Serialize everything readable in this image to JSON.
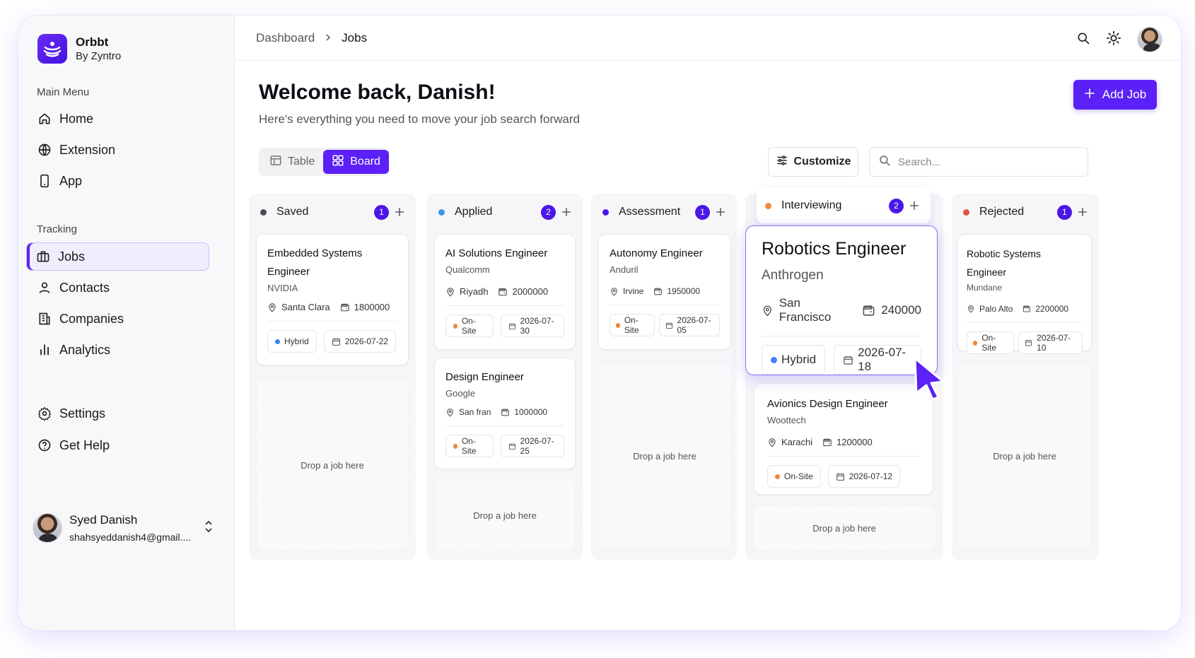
{
  "brand": {
    "name": "Orbbt",
    "sub": "By Zyntro"
  },
  "sidebar": {
    "main_menu_label": "Main Menu",
    "main_items": [
      {
        "label": "Home",
        "icon": "home-icon"
      },
      {
        "label": "Extension",
        "icon": "globe-icon"
      },
      {
        "label": "App",
        "icon": "phone-icon"
      }
    ],
    "tracking_label": "Tracking",
    "tracking_items": [
      {
        "label": "Jobs",
        "icon": "briefcase-icon",
        "active": true
      },
      {
        "label": "Contacts",
        "icon": "user-icon"
      },
      {
        "label": "Companies",
        "icon": "building-icon"
      },
      {
        "label": "Analytics",
        "icon": "bar-chart-icon"
      }
    ],
    "bottom_items": [
      {
        "label": "Settings",
        "icon": "gear-icon"
      },
      {
        "label": "Get Help",
        "icon": "help-icon"
      }
    ],
    "user": {
      "name": "Syed Danish",
      "email": "shahsyeddanish4@gmail...."
    }
  },
  "breadcrumb": {
    "parent": "Dashboard",
    "current": "Jobs"
  },
  "header": {
    "title": "Welcome back, Danish!",
    "subtitle": "Here's everything you need to move your job search forward",
    "add_job_label": "Add Job"
  },
  "toolbar": {
    "table_label": "Table",
    "board_label": "Board",
    "active_view": "Board",
    "customize_label": "Customize",
    "search_placeholder": "Search..."
  },
  "colors": {
    "accent": "#5b21f6",
    "saved": "#4b4b55",
    "applied": "#3b9ae8",
    "assessment": "#4b17e8",
    "interviewing": "#f08a3c",
    "rejected": "#e0533d",
    "hybrid": "#3b82f6",
    "onsite": "#f0883a"
  },
  "drop_label": "Drop a job here",
  "columns": [
    {
      "title": "Saved",
      "count": "1",
      "cards": [
        {
          "title": "Embedded Systems Engineer",
          "company": "NVIDIA",
          "location": "Santa Clara",
          "salary": "1800000",
          "mode": "Hybrid",
          "date": "2026-07-22"
        }
      ]
    },
    {
      "title": "Applied",
      "count": "2",
      "cards": [
        {
          "title": "AI Solutions Engineer",
          "company": "Qualcomm",
          "location": "Riyadh",
          "salary": "2000000",
          "mode": "On-Site",
          "date": "2026-07-30"
        },
        {
          "title": "Design Engineer",
          "company": "Google",
          "location": "San fran",
          "salary": "1000000",
          "mode": "On-Site",
          "date": "2026-07-25"
        }
      ]
    },
    {
      "title": "Assessment",
      "count": "1",
      "cards": [
        {
          "title": "Autonomy Engineer",
          "company": "Anduril",
          "location": "Irvine",
          "salary": "1950000",
          "mode": "On-Site",
          "date": "2026-07-05"
        }
      ]
    },
    {
      "title": "Interviewing",
      "count": "2",
      "cards": [
        {
          "title": "Robotics Engineer",
          "company": "Anthrogen",
          "location": "San Francisco",
          "salary": "240000",
          "mode": "Hybrid",
          "date": "2026-07-18"
        },
        {
          "title": "Avionics Design Engineer",
          "company": "Woottech",
          "location": "Karachi",
          "salary": "1200000",
          "mode": "On-Site",
          "date": "2026-07-12"
        }
      ]
    },
    {
      "title": "Rejected",
      "count": "1",
      "cards": [
        {
          "title": "Robotic Systems Engineer",
          "company": "Mundane",
          "location": "Palo Alto",
          "salary": "2200000",
          "mode": "On-Site",
          "date": "2026-07-10"
        }
      ]
    }
  ]
}
